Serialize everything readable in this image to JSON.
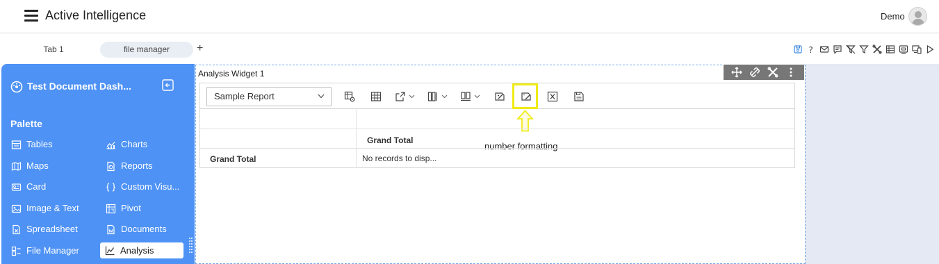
{
  "header": {
    "app_title": "Active Intelligence",
    "user_name": "Demo"
  },
  "tabs": [
    {
      "label": "Tab 1"
    },
    {
      "label": "file manager",
      "active": true
    }
  ],
  "tab_add_label": "+",
  "toolbar_icons": [
    "save-icon",
    "help-icon",
    "mail-icon",
    "comment-icon",
    "clear-filter-icon",
    "filter-icon",
    "tools-icon",
    "table-icon",
    "preview-icon",
    "device-icon",
    "play-icon"
  ],
  "sidebar": {
    "dashboard_title": "Test Document Dash...",
    "palette_label": "Palette",
    "items": [
      {
        "label": "Tables",
        "icon": "table-icon"
      },
      {
        "label": "Charts",
        "icon": "chart-icon"
      },
      {
        "label": "Maps",
        "icon": "map-icon"
      },
      {
        "label": "Reports",
        "icon": "report-icon"
      },
      {
        "label": "Card",
        "icon": "card-icon"
      },
      {
        "label": "Custom Visu...",
        "icon": "braces-icon"
      },
      {
        "label": "Image & Text",
        "icon": "image-icon"
      },
      {
        "label": "Pivot",
        "icon": "pivot-icon"
      },
      {
        "label": "Spreadsheet",
        "icon": "spreadsheet-icon"
      },
      {
        "label": "Documents",
        "icon": "document-icon"
      },
      {
        "label": "File Manager",
        "icon": "file-manager-icon"
      },
      {
        "label": "Analysis",
        "icon": "analysis-icon",
        "active": true
      }
    ]
  },
  "widget": {
    "title": "Analysis Widget 1",
    "report_select": {
      "value": "Sample Report"
    },
    "annotation": "number formatting",
    "grid": {
      "column_header": "Grand Total",
      "row_header": "Grand Total",
      "cell": "No records to disp..."
    }
  },
  "colors": {
    "sidebar": "#4e92f5",
    "highlight": "#f0eb16",
    "side_panel": "#e4e9f3"
  }
}
